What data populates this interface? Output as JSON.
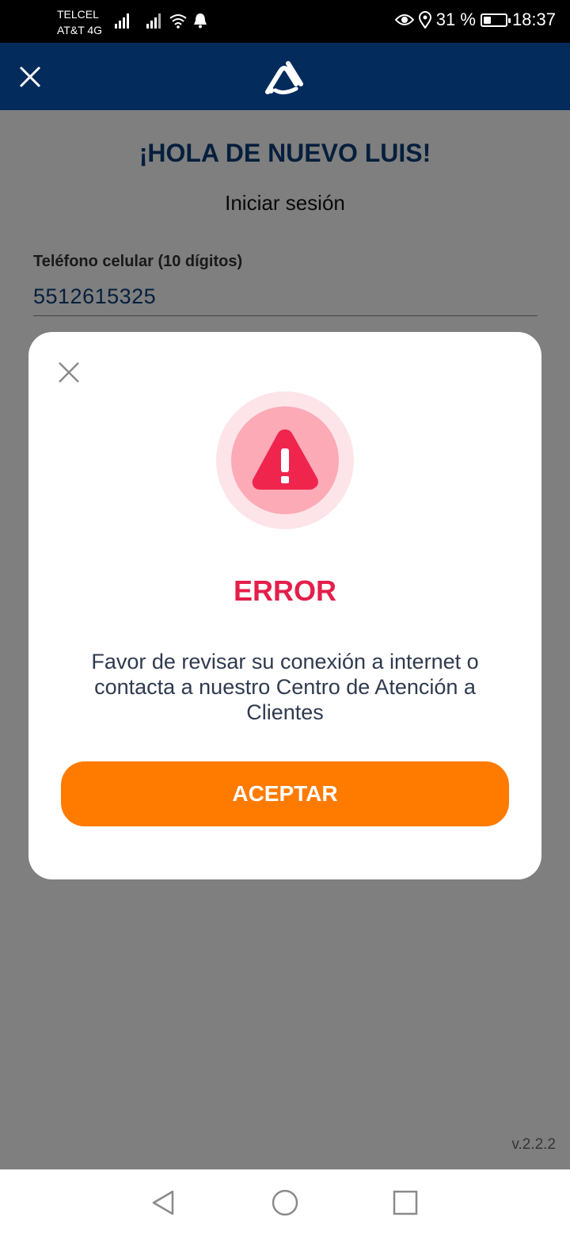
{
  "status_bar": {
    "carrier_1": "TELCEL",
    "carrier_2": "AT&T 4G",
    "battery_percent": "31 %",
    "battery_level": 0.31,
    "time": "18:37"
  },
  "header": {
    "close_icon": "close-icon",
    "logo_icon": "logo-icon",
    "background_color": "#032b5c"
  },
  "page": {
    "greeting": "¡HOLA DE NUEVO LUIS!",
    "subtitle": "Iniciar sesión",
    "phone_label": "Teléfono celular (10 dígitos)",
    "phone_value": "5512615325",
    "version": "v.2.2.2"
  },
  "modal": {
    "icon": "warning-icon",
    "title": "ERROR",
    "message": "Favor de revisar su conexión a internet o contacta a nuestro Centro de Atención a Clientes",
    "button_label": "ACEPTAR",
    "title_color": "#e41f4a",
    "button_color": "#ff7b00"
  },
  "nav_bar": {
    "back_icon": "back-triangle-icon",
    "home_icon": "home-circle-icon",
    "recents_icon": "recents-square-icon"
  }
}
